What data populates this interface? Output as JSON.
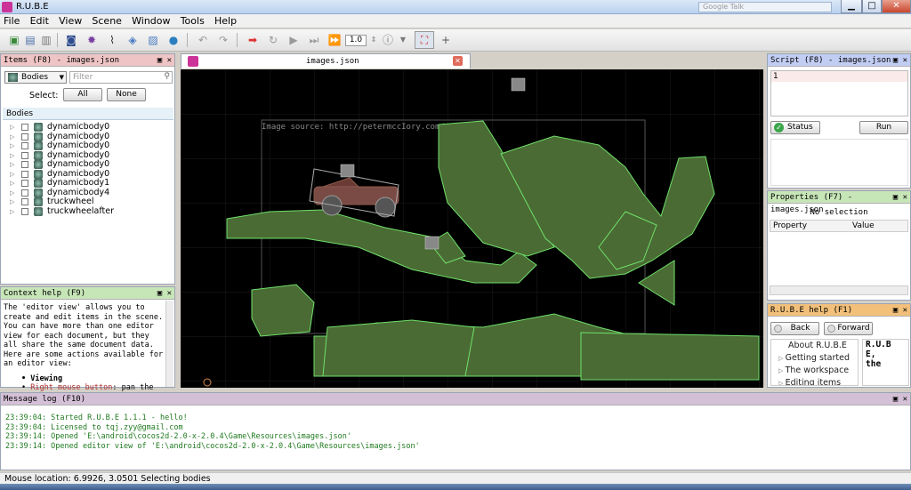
{
  "window": {
    "title": "R.U.B.E",
    "search_placeholder": "Google Talk",
    "min": "▁",
    "max": "□",
    "close": "✕"
  },
  "menu": [
    "File",
    "Edit",
    "View",
    "Scene",
    "Window",
    "Tools",
    "Help"
  ],
  "toolbar": {
    "step_value": "1.0"
  },
  "items_panel": {
    "title": "Items (F8) - images.json",
    "type_select": "Bodies",
    "filter_placeholder": "Filter",
    "select_label": "Select:",
    "all_label": "All",
    "none_label": "None",
    "list_header": "Bodies",
    "items": [
      "dynamicbody0",
      "dynamicbody0",
      "dynamicbody0",
      "dynamicbody0",
      "dynamicbody0",
      "dynamicbody0",
      "dynamicbody1",
      "dynamicbody4",
      "truckwheel",
      "truckwheelafter"
    ]
  },
  "context_help": {
    "title": "Context help (F9)",
    "body": "The 'editor view' allows you to create and edit items in the scene. You can have more than one editor view for each document, but they all share the same document data. Here are some actions available for an editor view:",
    "viewing": "Viewing",
    "rmb_label": "Right mouse button",
    "rmb_text": ": pan the scene"
  },
  "editor": {
    "tab_title": "images.json",
    "image_source": "Image source: http://petermccIory.com/"
  },
  "script_panel": {
    "title": "Script (F8) - images.json",
    "line_no": "1",
    "status_label": "Status",
    "run_label": "Run"
  },
  "properties_panel": {
    "title": "Properties (F7) - images.json",
    "no_selection": "No selection",
    "col_property": "Property",
    "col_value": "Value"
  },
  "help_panel": {
    "title": "R.U.B.E help (F1)",
    "back_label": "Back",
    "forward_label": "Forward",
    "topics": [
      "About R.U.B.E",
      "Getting started",
      "The workspace",
      "Editing items"
    ],
    "preview_lines": [
      "R.U.B",
      "E,",
      "the"
    ]
  },
  "message_log": {
    "title": "Message log (F10)",
    "lines": [
      "23:39:04: Started R.U.B.E 1.1.1 - hello!",
      "23:39:04: Licensed to tqj.zyy@gmail.com",
      "23:39:14: Opened 'E:\\android\\cocos2d-2.0-x-2.0.4\\Game\\Resources\\images.json'",
      "23:39:14: Opened editor view of 'E:\\android\\cocos2d-2.0-x-2.0.4\\Game\\Resources\\images.json'"
    ]
  },
  "status_bar": "Mouse location: 6.9926, 3.0501  Selecting bodies"
}
